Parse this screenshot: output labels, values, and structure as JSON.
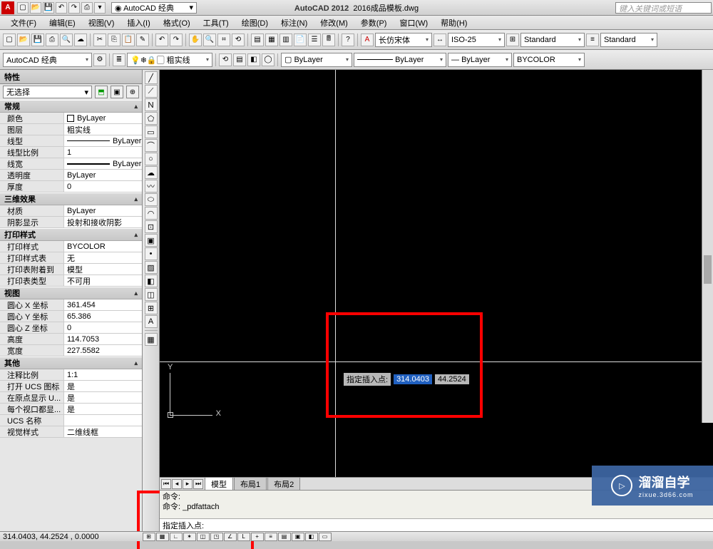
{
  "title": {
    "app": "AutoCAD 2012",
    "file": "2016成品模板.dwg"
  },
  "workspace": "AutoCAD 经典",
  "search_placeholder": "键入关键词或短语",
  "menus": [
    "文件(F)",
    "编辑(E)",
    "视图(V)",
    "插入(I)",
    "格式(O)",
    "工具(T)",
    "绘图(D)",
    "标注(N)",
    "修改(M)",
    "参数(P)",
    "窗口(W)",
    "帮助(H)"
  ],
  "style_bar": {
    "font": "长仿宋体",
    "dim": "ISO-25",
    "std1": "Standard",
    "std2": "Standard"
  },
  "layer_bar": {
    "layer": "粗实线",
    "bylayer1": "ByLayer",
    "bylayer2": "ByLayer",
    "bycolor": "BYCOLOR"
  },
  "props": {
    "title": "特性",
    "selection": "无选择",
    "sections": {
      "general": {
        "label": "常规",
        "rows": [
          {
            "k": "颜色",
            "v": "ByLayer",
            "sw": true
          },
          {
            "k": "图层",
            "v": "粗实线"
          },
          {
            "k": "线型",
            "v": "ByLayer",
            "line": true
          },
          {
            "k": "线型比例",
            "v": "1"
          },
          {
            "k": "线宽",
            "v": "ByLayer",
            "linet": true
          },
          {
            "k": "透明度",
            "v": "ByLayer"
          },
          {
            "k": "厚度",
            "v": "0"
          }
        ]
      },
      "three_d": {
        "label": "三维效果",
        "rows": [
          {
            "k": "材质",
            "v": "ByLayer"
          },
          {
            "k": "阴影显示",
            "v": "投射和接收阴影"
          }
        ]
      },
      "plot": {
        "label": "打印样式",
        "rows": [
          {
            "k": "打印样式",
            "v": "BYCOLOR"
          },
          {
            "k": "打印样式表",
            "v": "无"
          },
          {
            "k": "打印表附着到",
            "v": "模型"
          },
          {
            "k": "打印表类型",
            "v": "不可用"
          }
        ]
      },
      "view": {
        "label": "视图",
        "rows": [
          {
            "k": "圆心 X 坐标",
            "v": "361.454"
          },
          {
            "k": "圆心 Y 坐标",
            "v": "65.386"
          },
          {
            "k": "圆心 Z 坐标",
            "v": "0"
          },
          {
            "k": "高度",
            "v": "114.7053"
          },
          {
            "k": "宽度",
            "v": "227.5582"
          }
        ]
      },
      "misc": {
        "label": "其他",
        "rows": [
          {
            "k": "注释比例",
            "v": "1:1"
          },
          {
            "k": "打开 UCS 图标",
            "v": "是"
          },
          {
            "k": "在原点显示 U...",
            "v": "是"
          },
          {
            "k": "每个视口都显...",
            "v": "是"
          },
          {
            "k": "UCS 名称",
            "v": ""
          },
          {
            "k": "视觉样式",
            "v": "二维线框"
          }
        ]
      }
    }
  },
  "dyn_input": {
    "label": "指定插入点:",
    "x": "314.0403",
    "y": "44.2524"
  },
  "ucs": {
    "y": "Y",
    "x": "X"
  },
  "tabs": {
    "model": "模型",
    "layout1": "布局1",
    "layout2": "布局2"
  },
  "cmd": {
    "l1": "命令:",
    "l2": "命令: _pdfattach",
    "l3": "指定插入点:"
  },
  "status": {
    "coords": "314.0403, 44.2524 , 0.0000"
  },
  "watermark": {
    "name": "溜溜自学",
    "url": "zixue.3d66.com"
  }
}
